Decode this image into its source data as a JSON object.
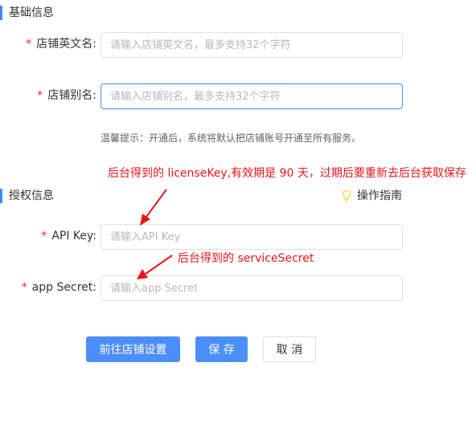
{
  "basic_section": {
    "title": "基础信息"
  },
  "fields": {
    "english_name": {
      "required_mark": "*",
      "label": "店铺英文名:",
      "placeholder": "请输入店铺英文名，最多支持32个字符",
      "value": ""
    },
    "alias": {
      "required_mark": "*",
      "label": "店铺别名:",
      "placeholder": "请输入店铺别名，最多支持32个字符",
      "value": ""
    },
    "api_key": {
      "required_mark": "*",
      "label": "API Key:",
      "placeholder": "请输入API Key",
      "value": ""
    },
    "app_secret": {
      "required_mark": "*",
      "label": "app Secret:",
      "placeholder": "请输入app Secret",
      "value": ""
    }
  },
  "hint": "温馨提示：开通后，系统将默认把店铺账号开通至所有服务。",
  "auth_section": {
    "title": "授权信息",
    "guide_label": "操作指南",
    "guide_icon": "lightbulb-icon"
  },
  "annotations": {
    "license": "后台得到的 licenseKey,有效期是 90 天，过期后要重新去后台获取保存",
    "secret": "后台得到的 serviceSecret"
  },
  "buttons": {
    "store_settings": "前往店铺设置",
    "save": "保 存",
    "cancel": "取 消"
  },
  "colors": {
    "accent": "#3c8dff",
    "primary_button": "#4b8ef7",
    "required": "#f5222d",
    "annotation": "#e8151a",
    "bulb": "#f7d84b"
  }
}
